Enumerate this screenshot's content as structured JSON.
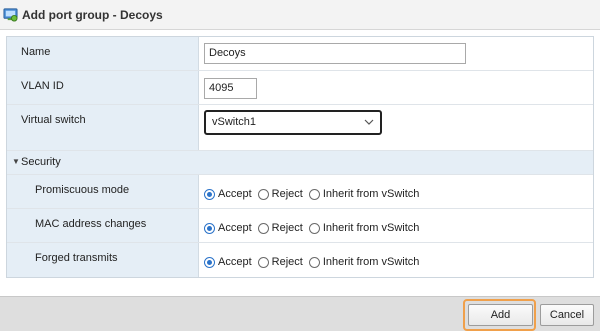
{
  "window": {
    "title": "Add port group - Decoys",
    "icon": "network-icon"
  },
  "form": {
    "name": {
      "label": "Name",
      "value": "Decoys"
    },
    "vlan": {
      "label": "VLAN ID",
      "value": "4095"
    },
    "vswitch": {
      "label": "Virtual switch",
      "value": "vSwitch1"
    },
    "security": {
      "label": "Security",
      "expanded": true,
      "options": [
        "Accept",
        "Reject",
        "Inherit from vSwitch"
      ],
      "rows": [
        {
          "label": "Promiscuous mode",
          "selected": "Accept"
        },
        {
          "label": "MAC address changes",
          "selected": "Accept"
        },
        {
          "label": "Forged transmits",
          "selected": "Accept"
        }
      ]
    }
  },
  "footer": {
    "add_label": "Add",
    "cancel_label": "Cancel"
  },
  "colors": {
    "accent": "#2b73c9",
    "focus": "#f0a04b",
    "label_bg": "#e5eef6"
  }
}
